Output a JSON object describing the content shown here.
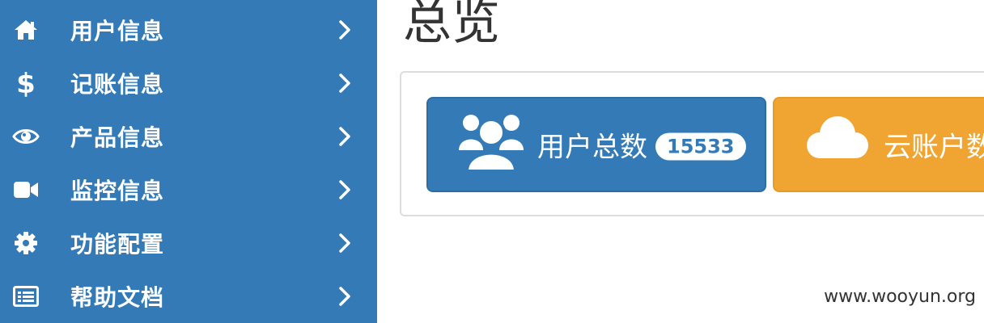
{
  "sidebar": {
    "items": [
      {
        "label": "用户信息",
        "icon": "home-icon"
      },
      {
        "label": "记账信息",
        "icon": "dollar-icon"
      },
      {
        "label": "产品信息",
        "icon": "eye-icon"
      },
      {
        "label": "监控信息",
        "icon": "video-camera-icon"
      },
      {
        "label": "功能配置",
        "icon": "gear-icon"
      },
      {
        "label": "帮助文档",
        "icon": "list-icon"
      }
    ]
  },
  "main": {
    "title": "总览",
    "stats": [
      {
        "label": "用户总数",
        "value": "15533",
        "icon": "users-icon",
        "color": "#337ab7"
      },
      {
        "label": "云账户数",
        "icon": "cloud-icon",
        "color": "#f0a432"
      }
    ]
  },
  "footer": {
    "watermark": "www.wooyun.org"
  },
  "colors": {
    "sidebar_bg": "#337ab7",
    "primary": "#337ab7",
    "warning": "#f0a432"
  }
}
